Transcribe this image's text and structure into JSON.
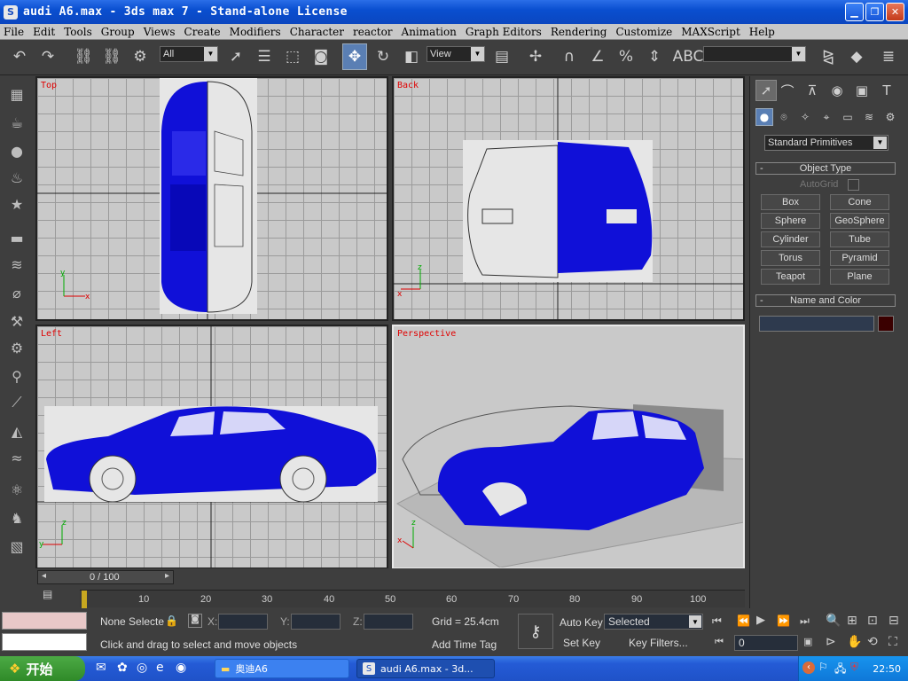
{
  "window": {
    "title": "audi A6.max - 3ds max 7  - Stand-alone License",
    "app_icon": "S"
  },
  "menu": [
    "File",
    "Edit",
    "Tools",
    "Group",
    "Views",
    "Create",
    "Modifiers",
    "Character",
    "reactor",
    "Animation",
    "Graph Editors",
    "Rendering",
    "Customize",
    "MAXScript",
    "Help"
  ],
  "toolbar": {
    "selection_filter": "All",
    "ref_coord": "View",
    "named_sel": ""
  },
  "viewports": {
    "top": "Top",
    "back": "Back",
    "left": "Left",
    "perspective": "Perspective"
  },
  "axes": {
    "x": "x",
    "y": "y",
    "z": "z"
  },
  "command_panel": {
    "category": "Standard Primitives",
    "object_type_title": "Object Type",
    "autogrid": "AutoGrid",
    "buttons": [
      "Box",
      "Cone",
      "Sphere",
      "GeoSphere",
      "Cylinder",
      "Tube",
      "Torus",
      "Pyramid",
      "Teapot",
      "Plane"
    ],
    "name_color_title": "Name and Color",
    "name_value": "",
    "color": "#3a0000"
  },
  "timeline": {
    "frame_display": "0 / 100",
    "ticks": [
      "10",
      "20",
      "30",
      "40",
      "50",
      "60",
      "70",
      "80",
      "90",
      "100"
    ],
    "frame": 0
  },
  "status": {
    "selection": "None Selecte",
    "x_label": "X:",
    "y_label": "Y:",
    "z_label": "Z:",
    "grid": "Grid = 25.4cm",
    "prompt": "Click and drag to select and move objects",
    "add_time_tag": "Add Time Tag",
    "auto_key": "Auto Key",
    "set_key": "Set Key",
    "key_mode": "Selected",
    "key_filters": "Key Filters...",
    "current_frame": "0"
  },
  "taskbar": {
    "start": "开始",
    "task1": "奥迪A6",
    "task2": "audi A6.max - 3d...",
    "clock": "22:50"
  },
  "colors": {
    "car": "#1010d8",
    "titlebar": "#0a4fd0",
    "viewport_bg": "#c9c9c9",
    "label": "#e00000"
  }
}
